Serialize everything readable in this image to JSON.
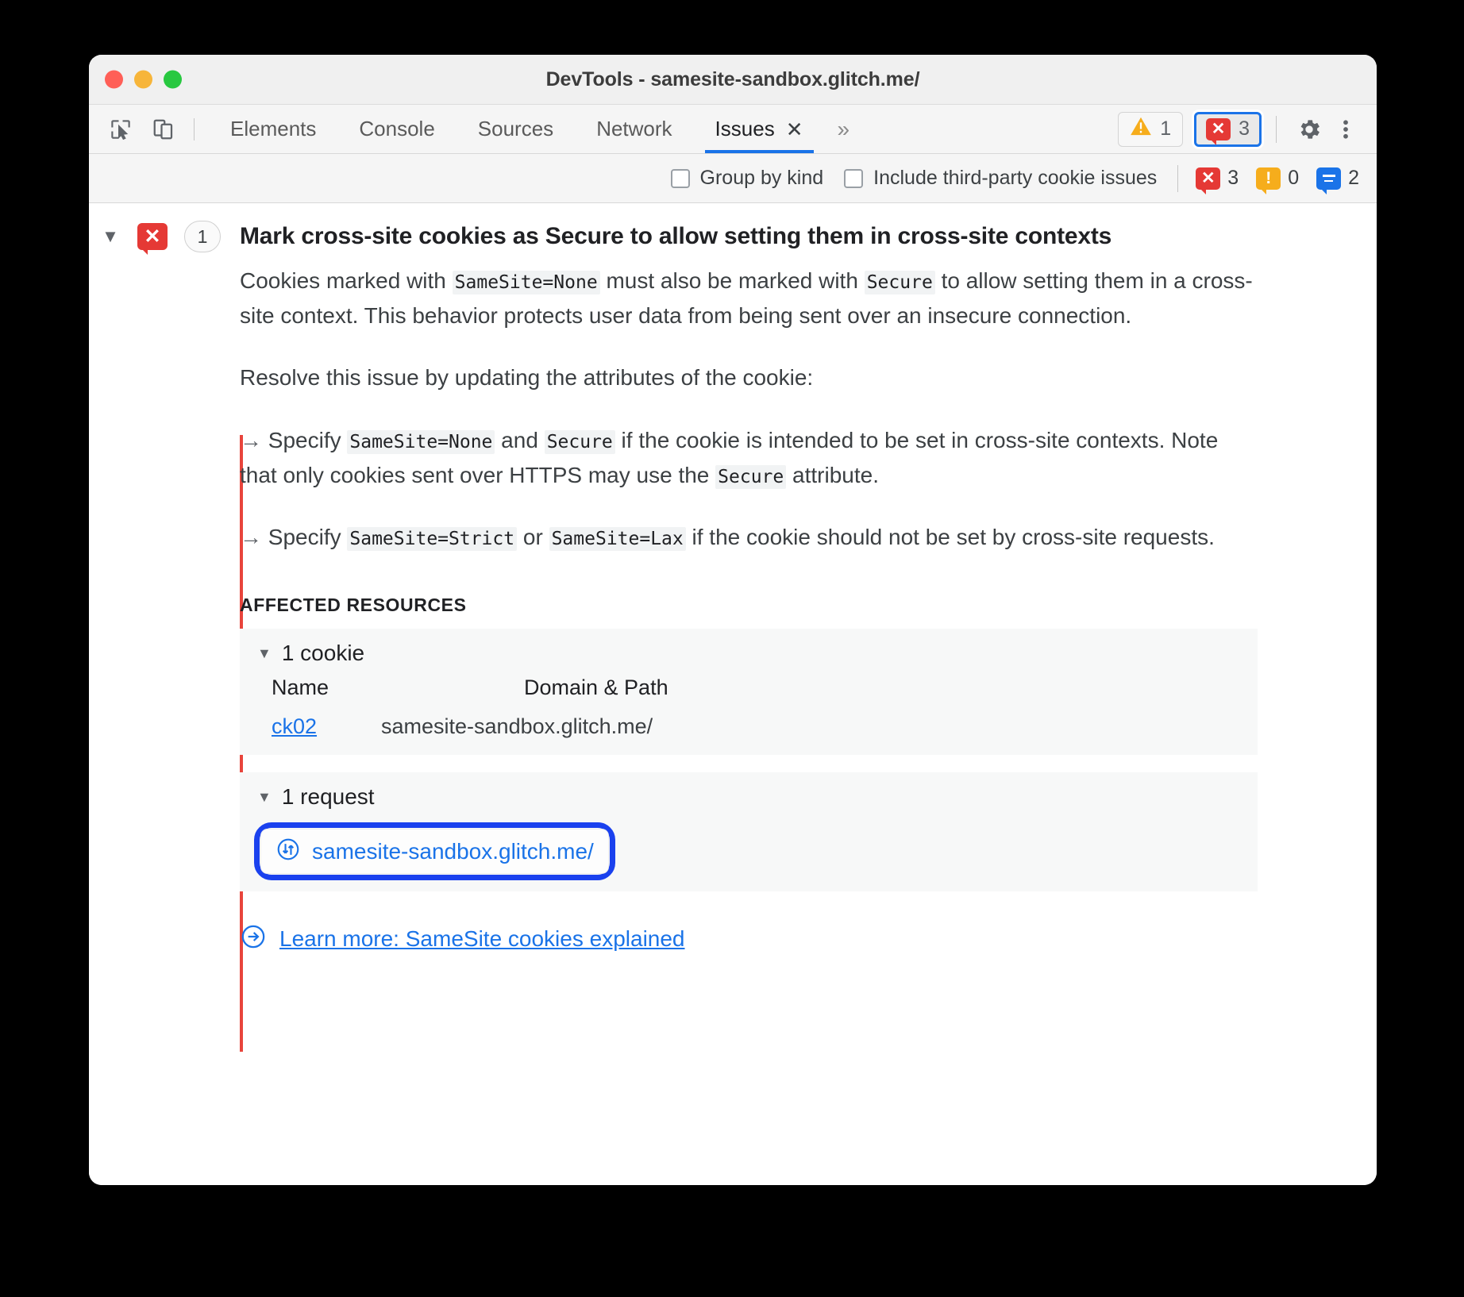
{
  "window": {
    "title": "DevTools - samesite-sandbox.glitch.me/",
    "traffic_lights": [
      "close",
      "minimize",
      "zoom"
    ]
  },
  "toolbar": {
    "inspect_icon": "inspect-cursor-icon",
    "device_icon": "device-toolbar-icon",
    "tabs": [
      {
        "label": "Elements",
        "active": false
      },
      {
        "label": "Console",
        "active": false
      },
      {
        "label": "Sources",
        "active": false
      },
      {
        "label": "Network",
        "active": false
      },
      {
        "label": "Issues",
        "active": true,
        "closeable": true
      }
    ],
    "close_glyph": "✕",
    "more_tabs_glyph": "»",
    "warning_count": "1",
    "error_count": "3",
    "settings_icon": "gear-icon",
    "menu_icon": "more-vertical-icon"
  },
  "filterbar": {
    "group_by_kind": {
      "label": "Group by kind",
      "checked": false
    },
    "third_party": {
      "label": "Include third-party cookie issues",
      "checked": false
    },
    "stats": [
      {
        "kind": "error",
        "count": "3"
      },
      {
        "kind": "warning",
        "count": "0"
      },
      {
        "kind": "info",
        "count": "2"
      }
    ]
  },
  "issue": {
    "twisty_glyph": "▼",
    "kind_icon": "error-badge-icon",
    "count": "1",
    "title": "Mark cross-site cookies as Secure to allow setting them in cross-site contexts",
    "paragraph1": {
      "t1": "Cookies marked with ",
      "c1": "SameSite=None",
      "t2": " must also be marked with ",
      "c2": "Secure",
      "t3": " to allow setting them in a cross-site context. This behavior protects user data from being sent over an insecure connection."
    },
    "paragraph2": "Resolve this issue by updating the attributes of the cookie:",
    "bullet1": {
      "arrow": "→",
      "t1": " Specify ",
      "c1": "SameSite=None",
      "t2": " and ",
      "c2": "Secure",
      "t3": " if the cookie is intended to be set in cross-site contexts. Note that only cookies sent over HTTPS may use the ",
      "c3": "Secure",
      "t4": " attribute."
    },
    "bullet2": {
      "arrow": "→",
      "t1": " Specify ",
      "c1": "SameSite=Strict",
      "t2": " or ",
      "c2": "SameSite=Lax",
      "t3": " if the cookie should not be set by cross-site requests."
    },
    "affected_resources_label": "AFFECTED RESOURCES",
    "cookies_section": {
      "twisty_glyph": "▼",
      "heading": "1 cookie",
      "columns": {
        "name": "Name",
        "domain": "Domain & Path"
      },
      "rows": [
        {
          "name": "ck02",
          "domain": "samesite-sandbox.glitch.me/"
        }
      ]
    },
    "requests_section": {
      "twisty_glyph": "▼",
      "heading": "1 request",
      "icon": "network-request-icon",
      "rows": [
        {
          "url": "samesite-sandbox.glitch.me/",
          "focused": true
        }
      ]
    },
    "learn_more": {
      "icon": "arrow-right-circle-icon",
      "label": "Learn more: SameSite cookies explained"
    }
  },
  "colors": {
    "error_red": "#e53935",
    "warning_orange": "#f6ad1c",
    "info_blue": "#1a73e8",
    "link_blue": "#1a73e8",
    "focus_ring_blue": "#1a41ee",
    "rail_red": "#e8453c",
    "tab_active_underline": "#1a73e8"
  }
}
